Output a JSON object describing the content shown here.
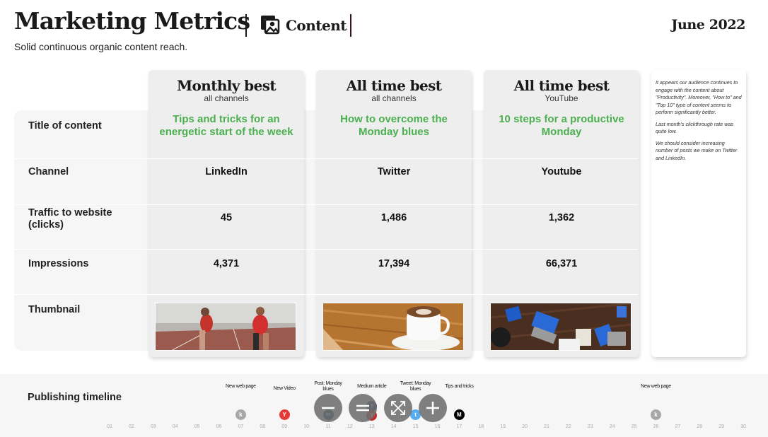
{
  "header": {
    "title": "Marketing Metrics",
    "section_icon": "image-gallery-icon",
    "section_label": "Content",
    "subtitle": "Solid continuous organic content reach.",
    "date": "June 2022"
  },
  "row_labels": [
    "Title of content",
    "Channel",
    "Traffic to website (clicks)",
    "Impressions",
    "Thumbnail"
  ],
  "cards": [
    {
      "heading": "Monthly best",
      "subheading": "all channels",
      "content_title": "Tips and tricks for an energetic start of the week",
      "channel": "LinkedIn",
      "traffic": "45",
      "impressions": "4,371",
      "thumbnail": "sprinters-on-track-photo"
    },
    {
      "heading": "All time best",
      "subheading": "all channels",
      "content_title": "How to overcome the Monday blues",
      "channel": "Twitter",
      "traffic": "1,486",
      "impressions": "17,394",
      "thumbnail": "coffee-cup-photo"
    },
    {
      "heading": "All time best",
      "subheading": "YouTube",
      "content_title": "10 steps for a productive Monday",
      "channel": "Youtube",
      "traffic": "1,362",
      "impressions": "66,371",
      "thumbnail": "team-laptops-photo"
    }
  ],
  "notes": [
    "It appears our audience continues to engage with the content about \"Productivity\". Moreover, \"How to\" and \"Top 10\" type of content seems to perform significantly better.",
    "Last month's clickthrough rate was quite low.",
    "We should consider increasing number of posts we make on Twitter and LinkedIn."
  ],
  "timeline": {
    "label": "Publishing timeline",
    "days": [
      "01",
      "02",
      "03",
      "04",
      "05",
      "06",
      "07",
      "08",
      "09",
      "10",
      "11",
      "12",
      "13",
      "14",
      "15",
      "16",
      "17",
      "18",
      "19",
      "20",
      "21",
      "22",
      "23",
      "24",
      "25",
      "26",
      "27",
      "28",
      "29",
      "30"
    ],
    "events": [
      {
        "day": 7,
        "label": "New web page",
        "icon": "web-page-icon",
        "glyph": "k",
        "color": "#a8a8a8"
      },
      {
        "day": 9,
        "label": "New Video",
        "icon": "youtube-icon",
        "glyph": "Y",
        "color": "#e53935"
      },
      {
        "day": 11,
        "label": "Post: Monday blues",
        "icon": "linkedin-icon",
        "glyph": "in",
        "color": "#0d4a6b"
      },
      {
        "day": 13,
        "label": "Medium article",
        "icon": "facebook-icon",
        "glyph": "f",
        "color": "#2b3f80"
      },
      {
        "day": 13,
        "label": "",
        "icon": "youtube-icon",
        "glyph": "Y",
        "color": "#c62828"
      },
      {
        "day": 15,
        "label": "Tweet: Monday blues",
        "icon": "twitter-icon",
        "glyph": "t",
        "color": "#55acee"
      },
      {
        "day": 17,
        "label": "Tips and tricks",
        "icon": "medium-icon",
        "glyph": "M",
        "color": "#000000"
      },
      {
        "day": 26,
        "label": "New web page",
        "icon": "web-page-icon",
        "glyph": "k",
        "color": "#a8a8a8"
      }
    ]
  },
  "zoom_controls": [
    "zoom-out",
    "reset-zoom",
    "fit-to-screen",
    "zoom-in"
  ],
  "colors": {
    "accent_green": "#4caf50",
    "card_bg": "#eeeeee",
    "band_bg": "#f6f6f6"
  }
}
